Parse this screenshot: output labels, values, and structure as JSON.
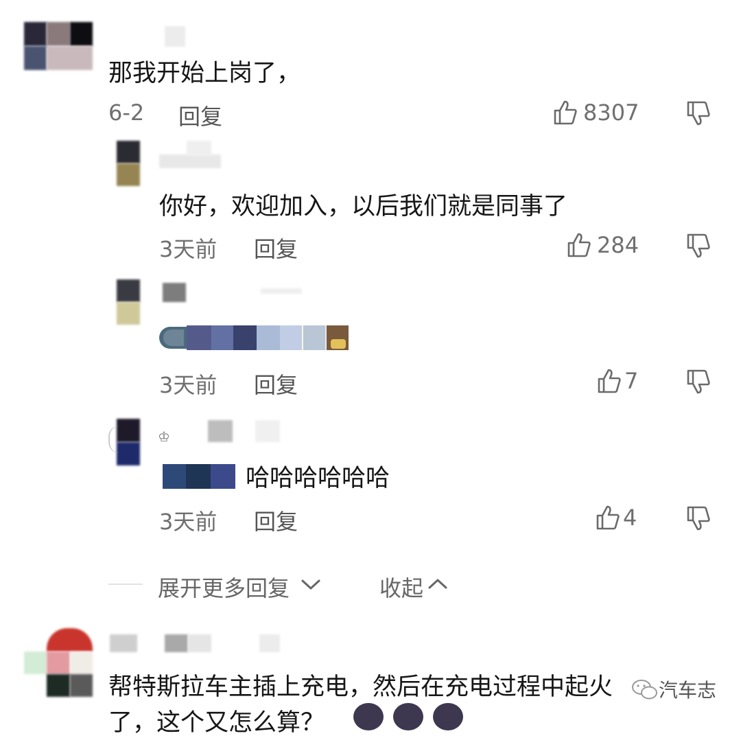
{
  "comments": [
    {
      "text": "那我开始上岗了，",
      "date": "6-2",
      "reply_label": "回复",
      "likes": "8307"
    },
    {
      "text": "你好，欢迎加入，以后我们就是同事了",
      "date": "3天前",
      "reply_label": "回复",
      "likes": "284"
    },
    {
      "text": "",
      "date": "3天前",
      "reply_label": "回复",
      "likes": "7"
    },
    {
      "text": "哈哈哈哈哈哈",
      "date": "3天前",
      "reply_label": "回复",
      "likes": "4"
    }
  ],
  "thread_actions": {
    "expand_label": "展开更多回复",
    "collapse_label": "收起"
  },
  "next_comment": {
    "line1": "帮特斯拉车主插上充电，然后在充电过程中起火",
    "line2": "了，这个又怎么算？"
  },
  "watermark": "汽车志",
  "colors": {
    "text": "#161616",
    "meta": "#6f6f6f",
    "divider": "#e2e2e2"
  },
  "icons": [
    "like-icon",
    "dislike-icon",
    "chevron-down-icon",
    "chevron-up-icon",
    "devil-emoji-icon",
    "wechat-icon"
  ]
}
